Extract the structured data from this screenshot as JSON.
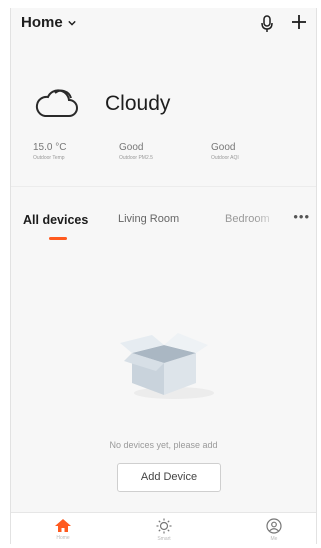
{
  "header": {
    "home_label": "Home",
    "chevron_icon": "chevron-down-icon",
    "mic_icon": "microphone-icon",
    "add_icon": "plus-icon"
  },
  "weather": {
    "icon": "cloud-icon",
    "condition": "Cloudy",
    "stats": [
      {
        "value": "15.0 °C",
        "label": "Outdoor Temp"
      },
      {
        "value": "Good",
        "label": "Outdoor PM2.5"
      },
      {
        "value": "Good",
        "label": "Outdoor AQI"
      }
    ]
  },
  "tabs": {
    "items": [
      {
        "label": "All devices"
      },
      {
        "label": "Living Room"
      },
      {
        "label": "Bedroom"
      }
    ],
    "more_icon": "more-horizontal-icon",
    "more_label": "•••"
  },
  "empty_state": {
    "illustration": "empty-box-icon",
    "message": "No devices yet, please add",
    "button_label": "Add Device"
  },
  "bottom_nav": {
    "items": [
      {
        "icon": "home-icon",
        "label": "Home"
      },
      {
        "icon": "scene-icon",
        "label": "Smart"
      },
      {
        "icon": "profile-icon",
        "label": "Me"
      }
    ]
  },
  "colors": {
    "accent": "#ff5a1f",
    "background": "#f7f7f7"
  }
}
